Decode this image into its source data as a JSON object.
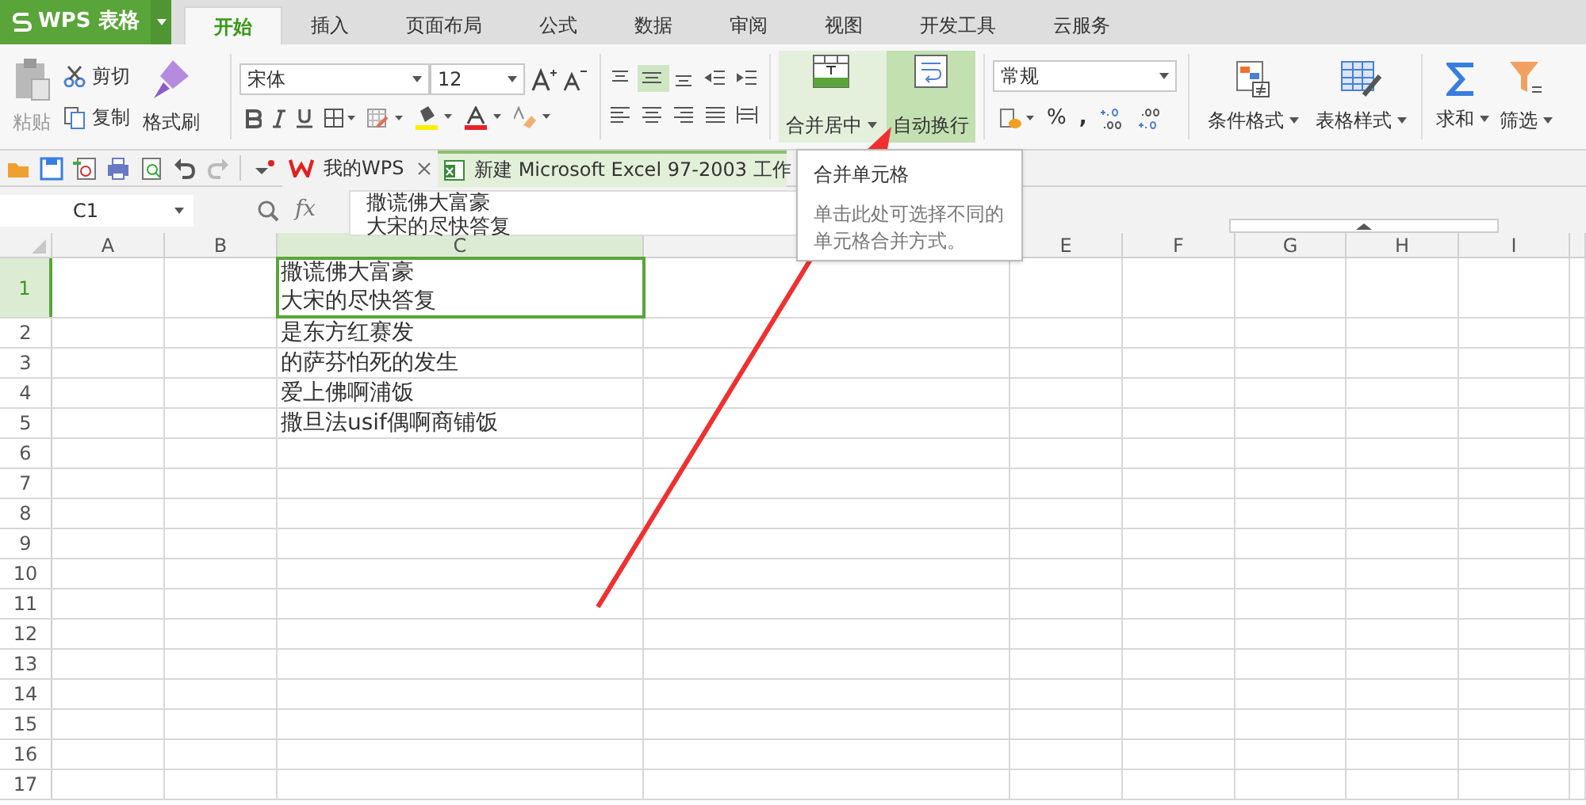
{
  "app_menu": {
    "label": "WPS 表格"
  },
  "tabs": [
    {
      "label": "开始",
      "selected": true
    },
    {
      "label": "插入",
      "selected": false
    },
    {
      "label": "页面布局",
      "selected": false
    },
    {
      "label": "公式",
      "selected": false
    },
    {
      "label": "数据",
      "selected": false
    },
    {
      "label": "审阅",
      "selected": false
    },
    {
      "label": "视图",
      "selected": false
    },
    {
      "label": "开发工具",
      "selected": false
    },
    {
      "label": "云服务",
      "selected": false
    }
  ],
  "ribbon": {
    "paste": "粘贴",
    "cut": "剪切",
    "copy": "复制",
    "format_painter": "格式刷",
    "font_name": "宋体",
    "font_size": "12",
    "merge_center": {
      "label": "合并居中",
      "selected": false
    },
    "wrap_text": {
      "label": "自动换行",
      "selected": true
    },
    "number_format": "常规",
    "percent": "%",
    "comma": ",",
    "conditional_format": "条件格式",
    "table_style": "表格样式",
    "sum": "求和",
    "filter": "筛选"
  },
  "doc_tabs": [
    {
      "label": "我的WPS",
      "selected": false
    },
    {
      "label": "新建 Microsoft Excel 97-2003 工作",
      "selected": true
    }
  ],
  "formula_bar": {
    "name_box": "C1",
    "fx": "fx",
    "lines": [
      "撒谎佛大富豪",
      "大宋的尽快答复"
    ]
  },
  "tooltip": {
    "title": "合并单元格",
    "body": "单击此处可选择不同的单元格合并方式。"
  },
  "columns": [
    "A",
    "B",
    "C",
    null,
    "E",
    "F",
    "G",
    "H",
    "I"
  ],
  "rows": [
    {
      "number": "1",
      "selected": true,
      "lines": [
        "撒谎佛大富豪",
        "大宋的尽快答复"
      ]
    },
    {
      "number": "2",
      "selected": false,
      "lines": [
        "是东方红赛发"
      ]
    },
    {
      "number": "3",
      "selected": false,
      "lines": [
        "的萨芬怕死的发生"
      ]
    },
    {
      "number": "4",
      "selected": false,
      "lines": [
        "爱上佛啊浦饭"
      ]
    },
    {
      "number": "5",
      "selected": false,
      "lines": [
        "撒旦法usif偶啊商铺饭"
      ]
    },
    {
      "number": "6",
      "selected": false,
      "lines": []
    },
    {
      "number": "7",
      "selected": false,
      "lines": []
    },
    {
      "number": "8",
      "selected": false,
      "lines": []
    },
    {
      "number": "9",
      "selected": false,
      "lines": []
    },
    {
      "number": "10",
      "selected": false,
      "lines": []
    },
    {
      "number": "11",
      "selected": false,
      "lines": []
    },
    {
      "number": "12",
      "selected": false,
      "lines": []
    },
    {
      "number": "13",
      "selected": false,
      "lines": []
    },
    {
      "number": "14",
      "selected": false,
      "lines": []
    },
    {
      "number": "15",
      "selected": false,
      "lines": []
    },
    {
      "number": "16",
      "selected": false,
      "lines": []
    },
    {
      "number": "17",
      "selected": false,
      "lines": []
    }
  ]
}
